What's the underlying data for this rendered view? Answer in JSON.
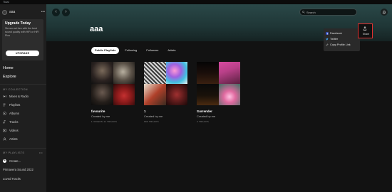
{
  "window": {
    "title": "Tidal"
  },
  "sidebar": {
    "profile_name": "aaa",
    "more": "•••",
    "upgrade": {
      "title": "Upgrade Today",
      "text": "Stream ad free with the best sound quality with HiFi or HiFi Plus",
      "button": "UPGRADE"
    },
    "nav": {
      "home": "Home",
      "explore": "Explore"
    },
    "collection_label": "MY COLLECTION",
    "collection": [
      {
        "label": "Mixes & Radio",
        "icon": "radio-icon"
      },
      {
        "label": "Playlists",
        "icon": "playlist-icon"
      },
      {
        "label": "Albums",
        "icon": "album-icon"
      },
      {
        "label": "Tracks",
        "icon": "tracks-icon"
      },
      {
        "label": "Videos",
        "icon": "video-icon"
      },
      {
        "label": "Artists",
        "icon": "artist-icon"
      }
    ],
    "playlists_label": "MY PLAYLISTS",
    "playlists_more": "•••",
    "create_label": "Create...",
    "playlists": [
      "Primavera Sound 2022",
      "Loved Tracks"
    ]
  },
  "header": {
    "search_placeholder": "Search",
    "back": "‹",
    "forward": "›"
  },
  "profile": {
    "name": "aaa",
    "tabs": [
      "Public Playlists",
      "Following",
      "Followers",
      "Artists"
    ],
    "active_tab": 0
  },
  "playlists": [
    {
      "title": "favourite",
      "creator": "Created by me",
      "meta": "1 VIDEOS 11 TRACKS"
    },
    {
      "title": "1",
      "creator": "Created by me",
      "meta": "990 TRACKS"
    },
    {
      "title": "Surrender",
      "creator": "Created by me",
      "meta": "4 TRACKS"
    }
  ],
  "share_menu": {
    "share_label": "Share",
    "items": [
      {
        "label": "Facebook",
        "icon": "facebook-icon"
      },
      {
        "label": "Twitter",
        "icon": "twitter-icon"
      },
      {
        "label": "Copy Profile Link",
        "icon": "link-icon"
      }
    ]
  },
  "colors": {
    "accent_highlight": "#e03030",
    "header_gradient": "#2a4848"
  }
}
